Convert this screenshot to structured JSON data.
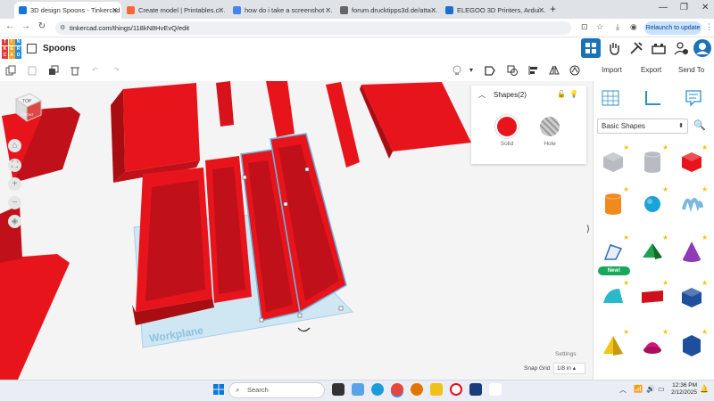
{
  "browser": {
    "tabs": [
      {
        "label": "3D design Spoons - Tinkercad",
        "active": true,
        "icon_color": "#1477d4"
      },
      {
        "label": "Create model | Printables.com",
        "active": false,
        "icon_color": "#fa6831"
      },
      {
        "label": "how do i take a screenshot on ...",
        "active": false,
        "icon_color": "#4285f4"
      },
      {
        "label": "forum.drucktipps3d.de/attache...",
        "active": false,
        "icon_color": "#666666"
      },
      {
        "label": "ELEGOO 3D Printers, Arduino K...",
        "active": false,
        "icon_color": "#1c6fd1"
      }
    ],
    "url": "tinkercad.com/things/118kN8HvEvQ/edit",
    "relaunch_label": "Relaunch to update"
  },
  "app": {
    "project_name": "Spoons",
    "logo_letters": [
      "T",
      "I",
      "N",
      "K",
      "E",
      "R",
      "C",
      "A",
      "D"
    ],
    "logo_colors": [
      "#e03a3e",
      "#f5a623",
      "#1f8fe3",
      "#e03a3e",
      "#f5a623",
      "#1f8fe3",
      "#e03a3e",
      "#f5a623",
      "#1f8fe3"
    ]
  },
  "toolbar": {
    "import_label": "Import",
    "export_label": "Export",
    "sendto_label": "Send To"
  },
  "inspector": {
    "title": "Shapes(2)",
    "solid_label": "Solid",
    "hole_label": "Hole",
    "solid_color": "#e8141c"
  },
  "viewcube": {
    "top_label": "TOP",
    "front_label": "FRONT"
  },
  "workplane": {
    "label": "Workplane",
    "settings_label": "Settings",
    "snap_label": "Snap Grid",
    "snap_value": "1/8 in"
  },
  "library": {
    "category": "Basic Shapes",
    "new_badge": "New!",
    "shapes": [
      {
        "name": "box-gray-shape",
        "color": "#b8bcc2"
      },
      {
        "name": "cylinder-gray-shape",
        "color": "#b8bcc2"
      },
      {
        "name": "box-shape",
        "color": "#e8141c"
      },
      {
        "name": "cylinder-shape",
        "color": "#f08a1c"
      },
      {
        "name": "sphere-shape",
        "color": "#1aa3d9"
      },
      {
        "name": "scribble-shape",
        "color": "#7ab8e0"
      },
      {
        "name": "sketch-shape",
        "color": "#2f6fb5"
      },
      {
        "name": "roof-shape",
        "color": "#22a04b"
      },
      {
        "name": "cone-shape",
        "color": "#8e3bb5"
      },
      {
        "name": "round-roof-shape",
        "color": "#2bb8c9"
      },
      {
        "name": "text-shape",
        "color": "#d0101c"
      },
      {
        "name": "polygon-box-shape",
        "color": "#1e4f9c"
      },
      {
        "name": "pyramid-shape",
        "color": "#f2c418"
      },
      {
        "name": "half-sphere-shape",
        "color": "#d6147a"
      },
      {
        "name": "polygon-shape",
        "color": "#1e4f9c"
      }
    ]
  },
  "taskbar": {
    "search_placeholder": "Search",
    "time": "12:36 PM",
    "date": "2/12/2025"
  }
}
